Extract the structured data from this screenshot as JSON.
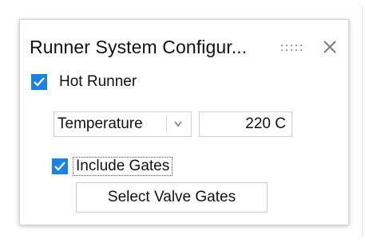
{
  "dialog": {
    "title": "Runner System Configur...",
    "grip_icon": "drag-grip-icon",
    "close_icon": "close-icon"
  },
  "hot_runner": {
    "label": "Hot Runner",
    "checked": true
  },
  "temperature": {
    "select_value": "Temperature",
    "dropdown_icon": "chevron-down-icon",
    "value": "220 C"
  },
  "include_gates": {
    "label": "Include Gates",
    "checked": true
  },
  "select_valve_gates": {
    "label": "Select Valve Gates"
  },
  "colors": {
    "checkbox": "#1a82e2",
    "panel_border": "#d6d6d6"
  }
}
